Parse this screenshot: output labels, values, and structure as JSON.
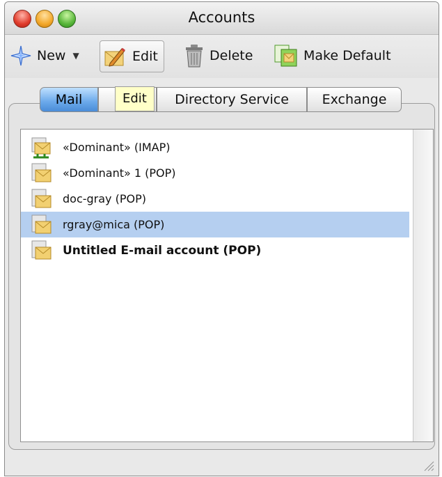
{
  "window": {
    "title": "Accounts"
  },
  "toolbar": {
    "new_label": "New",
    "edit_label": "Edit",
    "delete_label": "Delete",
    "make_default_label": "Make Default"
  },
  "tooltip": {
    "text": "Edit"
  },
  "tabs": [
    {
      "label": "Mail",
      "selected": true
    },
    {
      "label": "",
      "selected": false
    },
    {
      "label": "Directory Service",
      "selected": false
    },
    {
      "label": "Exchange",
      "selected": false
    }
  ],
  "accounts": [
    {
      "label": "«Dominant» (IMAP)",
      "icon": "imap-account-icon",
      "selected": false,
      "bold": false
    },
    {
      "label": "«Dominant» 1 (POP)",
      "icon": "pop-account-icon",
      "selected": false,
      "bold": false
    },
    {
      "label": "doc-gray (POP)",
      "icon": "pop-account-icon",
      "selected": false,
      "bold": false
    },
    {
      "label": "rgray@mica (POP)",
      "icon": "pop-account-icon",
      "selected": true,
      "bold": false
    },
    {
      "label": "Untitled E-mail account (POP)",
      "icon": "pop-account-icon",
      "selected": false,
      "bold": true
    }
  ],
  "colors": {
    "selection": "#b5cff0",
    "tab_selected": "#6aa8ea",
    "tooltip": "#ffffc8"
  }
}
